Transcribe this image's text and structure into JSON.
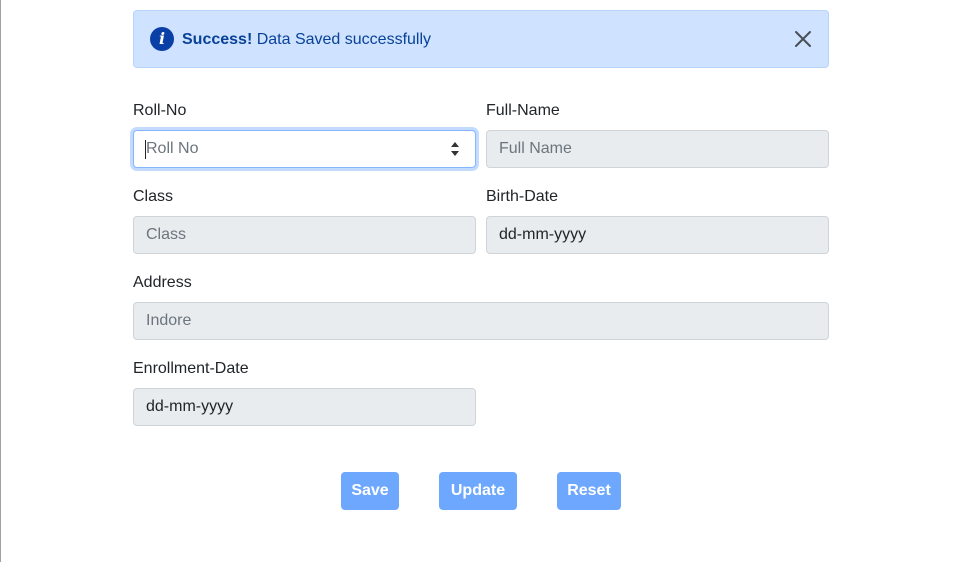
{
  "alert": {
    "icon": "info-icon",
    "icon_glyph": "i",
    "strong": "Success!",
    "message": " Data Saved successfully",
    "close_icon": "close-icon"
  },
  "form": {
    "rollno": {
      "label": "Roll-No",
      "placeholder": "Roll No"
    },
    "fullname": {
      "label": "Full-Name",
      "placeholder": "Full Name"
    },
    "class": {
      "label": "Class",
      "placeholder": "Class"
    },
    "birthdate": {
      "label": "Birth-Date",
      "value": "dd-mm-yyyy"
    },
    "address": {
      "label": "Address",
      "placeholder": "Indore"
    },
    "enrollment": {
      "label": "Enrollment-Date",
      "value": "dd-mm-yyyy"
    }
  },
  "buttons": {
    "save": "Save",
    "update": "Update",
    "reset": "Reset"
  },
  "colors": {
    "alert_bg": "#cfe2ff",
    "alert_text": "#084298",
    "disabled_field_bg": "#e9ecef",
    "button_bg": "#6ea8fe",
    "focus_border": "#86b7fe"
  }
}
